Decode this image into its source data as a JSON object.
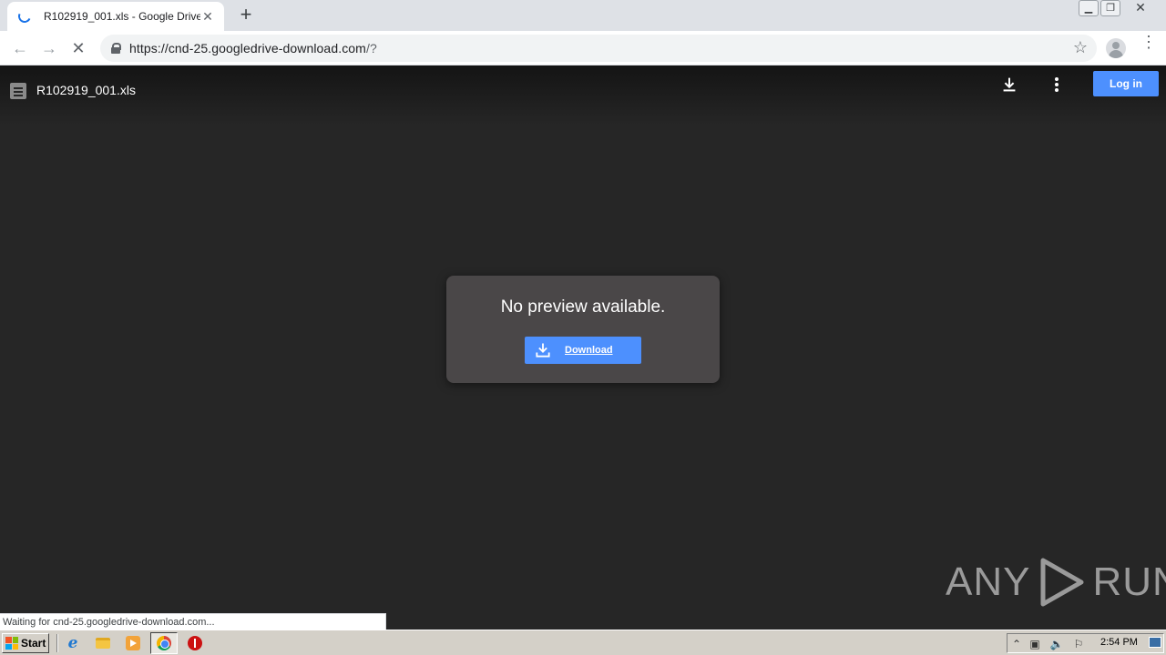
{
  "browser": {
    "tab_title": "R102919_001.xls - Google Drive",
    "tab_close": "✕",
    "new_tab": "+",
    "url_host": "https://cnd-25.googledrive-download.com",
    "url_path": "/?",
    "status_text": "Waiting for cnd-25.googledrive-download.com..."
  },
  "viewer": {
    "file_name": "R102919_001.xls",
    "login_label": "Log in",
    "preview_message": "No preview available.",
    "download_label": "Download"
  },
  "watermark": {
    "left": "ANY",
    "right": "RUN"
  },
  "taskbar": {
    "start_label": "Start",
    "clock": "2:54 PM"
  },
  "colors": {
    "accent_blue": "#4d90fe",
    "viewer_bg": "#262626",
    "card_bg": "#4a4748"
  }
}
